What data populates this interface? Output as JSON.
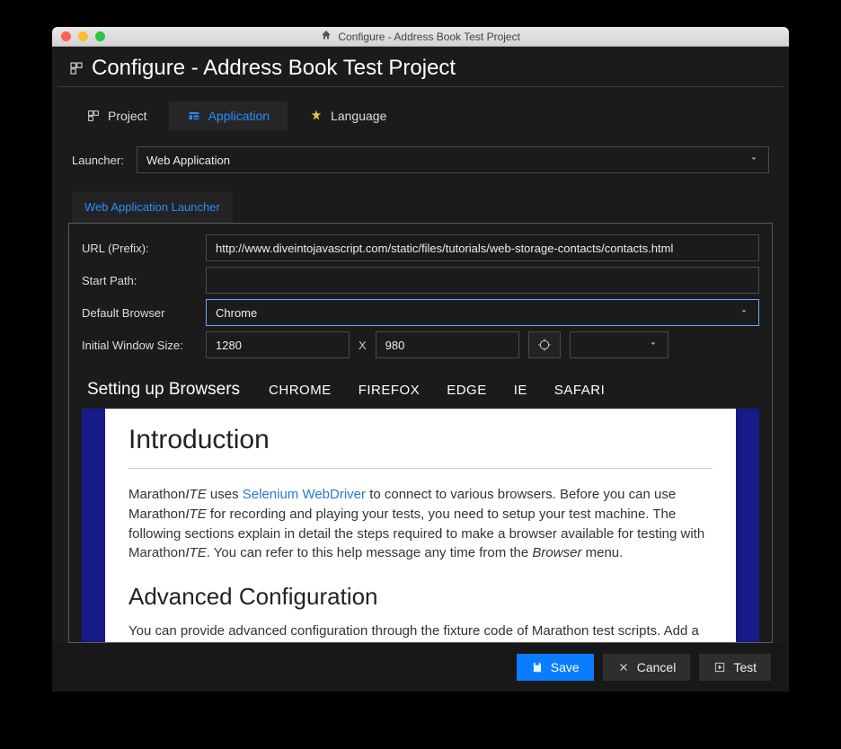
{
  "titlebar": {
    "text": "Configure - Address Book Test Project"
  },
  "page_heading": "Configure - Address Book Test Project",
  "tabs": {
    "project": "Project",
    "application": "Application",
    "language": "Language"
  },
  "launcher": {
    "label": "Launcher:",
    "value": "Web Application",
    "subtab": "Web Application Launcher"
  },
  "form": {
    "url_label": "URL (Prefix):",
    "url_value": "http://www.diveintojavascript.com/static/files/tutorials/web-storage-contacts/contacts.html",
    "start_path_label": "Start Path:",
    "start_path_value": "",
    "browser_label": "Default Browser",
    "browser_value": "Chrome",
    "size_label": "Initial Window Size:",
    "width": "1280",
    "x": "X",
    "height": "980"
  },
  "browser_band": {
    "heading": "Setting up Browsers",
    "items": [
      "CHROME",
      "FIREFOX",
      "EDGE",
      "IE",
      "SAFARI"
    ]
  },
  "doc": {
    "h1": "Introduction",
    "p1_a": "Marathon",
    "p1_b": "ITE",
    "p1_c": " uses ",
    "p1_link": "Selenium WebDriver",
    "p1_d": " to connect to various browsers. Before you can use Marathon",
    "p1_e": "ITE",
    "p1_f": " for recording and playing your tests, you need to setup your test machine. The following sections explain in detail the steps required to make a browser available for testing with Marathon",
    "p1_g": "ITE",
    "p1_h": ". You can refer to this help message any time from the ",
    "p1_i": "Browser",
    "p1_j": " menu.",
    "h2": "Advanced Configuration",
    "p2": "You can provide advanced configuration through the fixture code of Marathon test scripts. Add a"
  },
  "footer": {
    "save": "Save",
    "cancel": "Cancel",
    "test": "Test"
  }
}
